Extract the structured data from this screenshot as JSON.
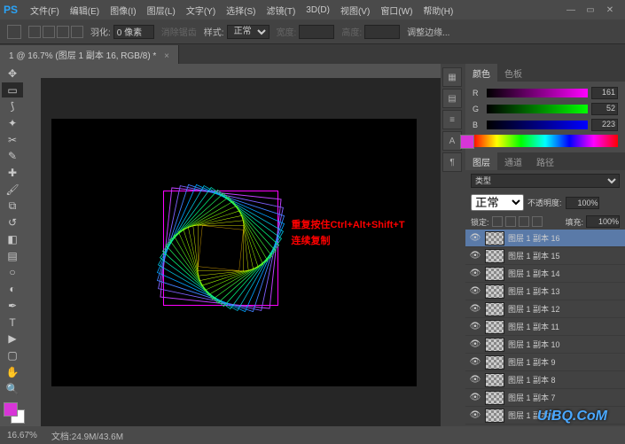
{
  "app": {
    "logo": "PS"
  },
  "menu": {
    "file": "文件(F)",
    "edit": "编辑(E)",
    "image": "图像(I)",
    "layer": "图层(L)",
    "type": "文字(Y)",
    "select": "选择(S)",
    "filter": "滤镜(T)",
    "threeD": "3D(D)",
    "view": "视图(V)",
    "window": "窗口(W)",
    "help": "帮助(H)"
  },
  "options": {
    "feather_label": "羽化:",
    "feather_value": "0 像素",
    "anti_alias": "消除锯齿",
    "style_label": "样式:",
    "style_value": "正常",
    "width_label": "宽度:",
    "height_label": "高度:",
    "refine": "调整边缘..."
  },
  "tab": {
    "title": "1 @ 16.7% (图层 1 副本 16, RGB/8) *",
    "close": "×"
  },
  "canvas": {
    "red_line1": "重复按住Ctrl+Alt+Shift+T",
    "red_line2": "连续复制"
  },
  "color_panel": {
    "tab_color": "颜色",
    "tab_swatch": "色板",
    "r_label": "R",
    "r_value": "161",
    "g_label": "G",
    "g_value": "52",
    "b_label": "B",
    "b_value": "223"
  },
  "layers_panel": {
    "tab_layers": "图层",
    "tab_channels": "通道",
    "tab_paths": "路径",
    "kind_label": "类型",
    "blend_mode": "正常",
    "opacity_label": "不透明度:",
    "opacity_value": "100%",
    "lock_label": "锁定:",
    "fill_label": "填充:",
    "fill_value": "100%",
    "layers": [
      "图层 1 副本 16",
      "图层 1 副本 15",
      "图层 1 副本 14",
      "图层 1 副本 13",
      "图层 1 副本 12",
      "图层 1 副本 11",
      "图层 1 副本 10",
      "图层 1 副本 9",
      "图层 1 副本 8",
      "图层 1 副本 7",
      "图层 1 副本 6"
    ]
  },
  "status": {
    "zoom": "16.67%",
    "doc_label": "文档:",
    "doc_size": "24.9M/43.6M"
  },
  "watermark": "UiBQ.CoM",
  "icons": {
    "minimize": "—",
    "maximize": "▭",
    "close": "✕",
    "eye": "👁"
  }
}
